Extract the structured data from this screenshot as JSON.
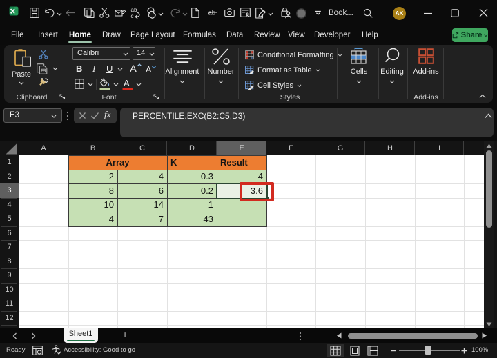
{
  "window": {
    "workbook_title": "Book...",
    "avatar_initials": "AK",
    "qat_icons": [
      "excel-logo",
      "save",
      "undo",
      "back",
      "copy",
      "cut",
      "email-edit",
      "replace",
      "touch-pointer",
      "redo",
      "new-file",
      "strikethrough",
      "camera",
      "form",
      "edit-document",
      "lock-person",
      "presence-circle",
      "qat-overflow",
      "search"
    ]
  },
  "menu": {
    "items": [
      "File",
      "Insert",
      "Home",
      "Draw",
      "Page Layout",
      "Formulas",
      "Data",
      "Review",
      "View",
      "Developer",
      "Help"
    ],
    "active": "Home",
    "share_label": "Share"
  },
  "ribbon": {
    "paste_label": "Paste",
    "clipboard_group_label": "Clipboard",
    "font_group_label": "Font",
    "font_name": "Calibri",
    "font_size": "14",
    "bold": "B",
    "italic": "I",
    "underline": "U",
    "alignment_label": "Alignment",
    "number_label": "Number",
    "styles_items": [
      "Conditional Formatting",
      "Format as Table",
      "Cell Styles"
    ],
    "styles_group_label": "Styles",
    "cells_label": "Cells",
    "editing_label": "Editing",
    "addins_label": "Add-ins",
    "addins_group_label": "Add-ins"
  },
  "formula_bar": {
    "name_box": "E3",
    "fx_label": "fx",
    "formula": "=PERCENTILE.EXC(B2:C5,D3)"
  },
  "grid": {
    "col_headers": [
      "A",
      "B",
      "C",
      "D",
      "E",
      "F",
      "G",
      "H",
      "I"
    ],
    "row_headers": [
      "1",
      "2",
      "3",
      "4",
      "5",
      "6",
      "7",
      "8",
      "9",
      "10",
      "11",
      "12"
    ],
    "selected_col": "E",
    "selected_row": "3",
    "table": {
      "array_header": "Array",
      "k_header": "K",
      "result_header": "Result",
      "rows": [
        [
          "2",
          "4",
          "0.3",
          "4"
        ],
        [
          "8",
          "6",
          "0.2",
          "3.6"
        ],
        [
          "10",
          "14",
          "1",
          ""
        ],
        [
          "4",
          "7",
          "43",
          ""
        ]
      ]
    }
  },
  "sheet_tabs": {
    "active_tab": "Sheet1",
    "add_label": "+"
  },
  "status_bar": {
    "mode": "Ready",
    "accessibility": "Accessibility: Good to go",
    "zoom_level": "100%"
  },
  "colors": {
    "share_green": "#3fa75f",
    "menu_underline_green": "#9dc3ab",
    "tab_underline_green": "#217346",
    "header_orange": "#ED7D31",
    "cell_green": "#C6E0B4",
    "annotation_red": "#d22b20",
    "addins_orange": "#c74f34",
    "avatar_gold": "#a98016"
  }
}
